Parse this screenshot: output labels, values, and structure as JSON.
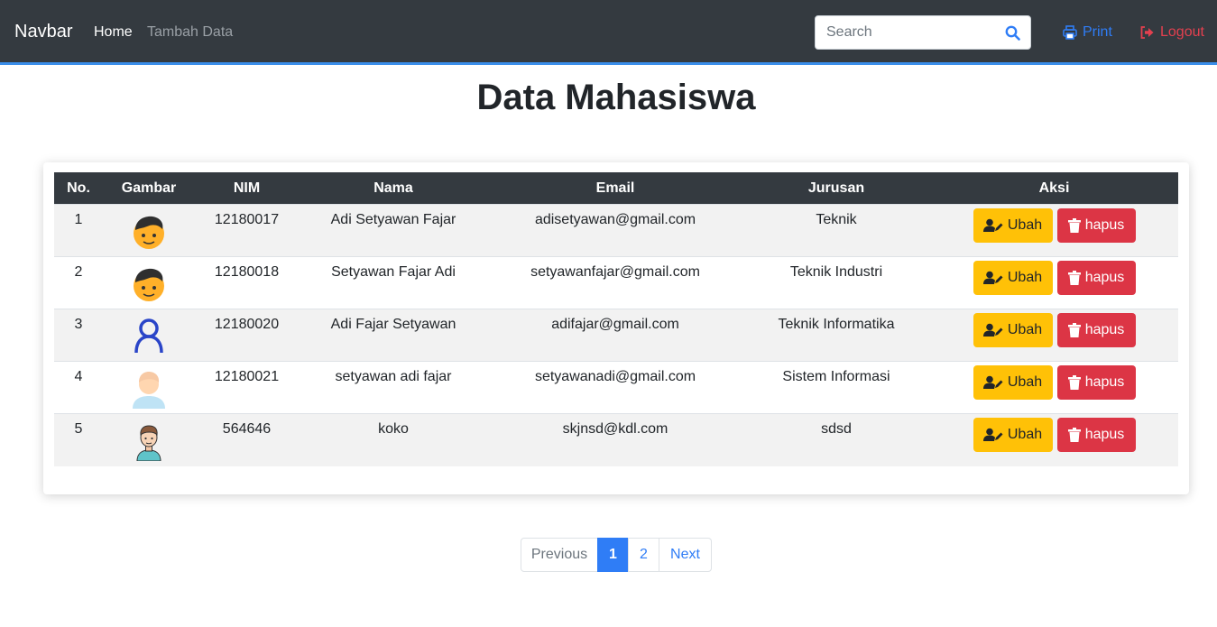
{
  "navbar": {
    "brand": "Navbar",
    "links": [
      {
        "label": "Home"
      },
      {
        "label": "Tambah Data"
      }
    ],
    "search_placeholder": "Search",
    "print_label": "Print",
    "logout_label": "Logout",
    "colors": {
      "background": "#343a40",
      "print": "#2f7df6",
      "logout": "#e3404f"
    }
  },
  "page_title": "Data Mahasiswa",
  "table": {
    "headers": [
      "No.",
      "Gambar",
      "NIM",
      "Nama",
      "Email",
      "Jurusan",
      "Aksi"
    ],
    "rows": [
      {
        "no": "1",
        "avatar": "boy-emoji-avatar",
        "nim": "12180017",
        "nama": "Adi Setyawan Fajar",
        "email": "adisetyawan@gmail.com",
        "jurusan": "Teknik"
      },
      {
        "no": "2",
        "avatar": "boy-emoji-avatar",
        "nim": "12180018",
        "nama": "Setyawan Fajar Adi",
        "email": "setyawanfajar@gmail.com",
        "jurusan": "Teknik Industri"
      },
      {
        "no": "3",
        "avatar": "user-outline-avatar",
        "nim": "12180020",
        "nama": "Adi Fajar Setyawan",
        "email": "adifajar@gmail.com",
        "jurusan": "Teknik Informatika"
      },
      {
        "no": "4",
        "avatar": "person-light-avatar",
        "nim": "12180021",
        "nama": "setyawan adi fajar",
        "email": "setyawanadi@gmail.com",
        "jurusan": "Sistem Informasi"
      },
      {
        "no": "5",
        "avatar": "man-cartoon-avatar",
        "nim": "564646",
        "nama": "koko",
        "email": "skjnsd@kdl.com",
        "jurusan": "sdsd"
      }
    ],
    "actions": {
      "edit_label": "Ubah",
      "delete_label": "hapus"
    }
  },
  "pagination": {
    "previous": "Previous",
    "pages": [
      "1",
      "2"
    ],
    "current": "1",
    "next": "Next"
  }
}
